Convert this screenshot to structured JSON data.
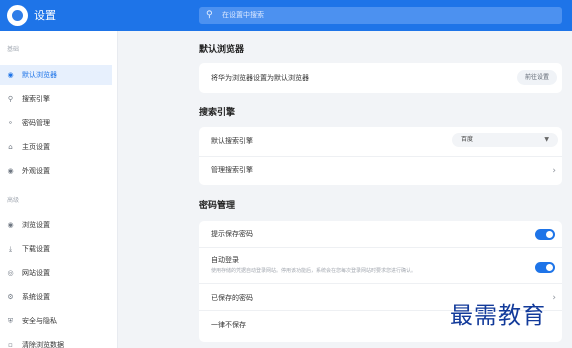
{
  "app": {
    "title": "设置"
  },
  "search": {
    "placeholder": "在设置中搜索"
  },
  "sidebar": {
    "groups": [
      {
        "title": "基础",
        "items": [
          {
            "label": "默认浏览器",
            "icon": "globe-icon"
          },
          {
            "label": "搜索引擎",
            "icon": "search-icon"
          },
          {
            "label": "密码管理",
            "icon": "key-icon"
          },
          {
            "label": "主页设置",
            "icon": "home-icon"
          },
          {
            "label": "外观设置",
            "icon": "palette-icon"
          }
        ]
      },
      {
        "title": "高级",
        "items": [
          {
            "label": "浏览设置",
            "icon": "eye-icon"
          },
          {
            "label": "下载设置",
            "icon": "download-icon"
          },
          {
            "label": "网站设置",
            "icon": "site-icon"
          },
          {
            "label": "系统设置",
            "icon": "gear-icon"
          },
          {
            "label": "安全与隐私",
            "icon": "shield-icon"
          },
          {
            "label": "清除浏览数据",
            "icon": "trash-icon"
          }
        ]
      }
    ],
    "active": "默认浏览器"
  },
  "sections": {
    "default_browser": {
      "title": "默认浏览器",
      "row_label": "将华为浏览器设置为默认浏览器",
      "button": "前往设置"
    },
    "search_engine": {
      "title": "搜索引擎",
      "default_label": "默认搜索引擎",
      "default_value": "百度",
      "manage_label": "管理搜索引擎"
    },
    "passwords": {
      "title": "密码管理",
      "prompt_label": "提示保存密码",
      "prompt_enabled": true,
      "autologin_label": "自动登录",
      "autologin_desc": "使用存储的凭据自动登录网站。停用该功能后，系统会在您每次登录网站时要求您进行确认。",
      "autologin_enabled": true,
      "saved_label": "已保存的密码",
      "never_label": "一律不保存"
    }
  },
  "watermark": "最需教育",
  "colors": {
    "accent": "#1e74e8",
    "background": "#f2f4f7"
  }
}
